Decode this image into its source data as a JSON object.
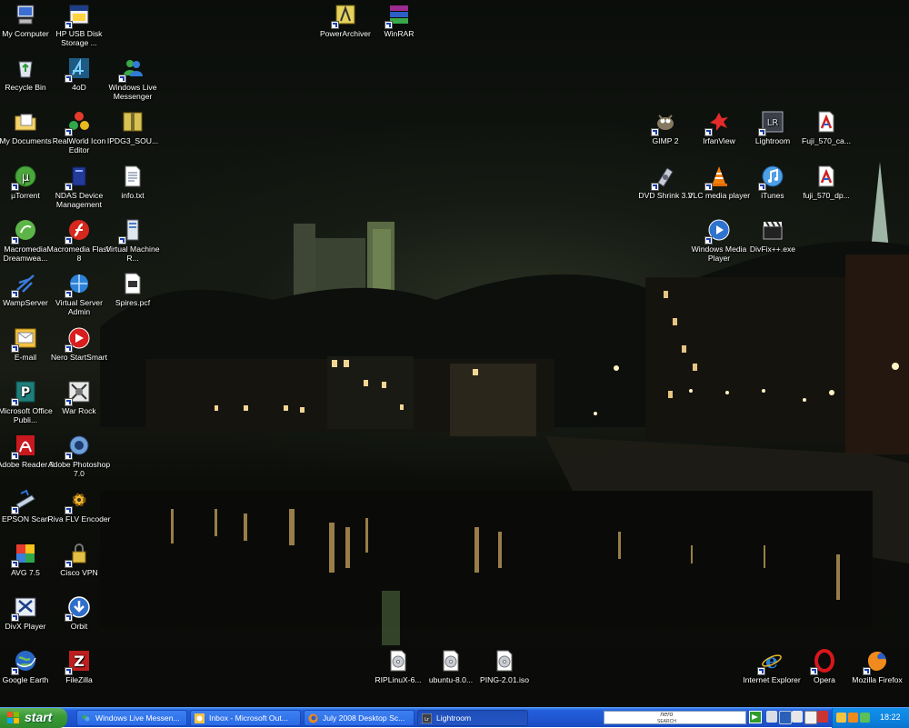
{
  "desktop": {
    "icons": {
      "my_computer": {
        "label": "My Computer",
        "icon": "computer-icon"
      },
      "hp_usb": {
        "label": "HP USB Disk Storage ...",
        "icon": "usb-disk-icon"
      },
      "recycle_bin": {
        "label": "Recycle Bin",
        "icon": "recycle-bin-icon"
      },
      "fourod": {
        "label": "4oD",
        "icon": "4od-icon"
      },
      "wlm": {
        "label": "Windows Live Messenger",
        "icon": "messenger-icon"
      },
      "my_documents": {
        "label": "My Documents",
        "icon": "folder-icon"
      },
      "realworld": {
        "label": "RealWorld Icon Editor",
        "icon": "icon-editor-icon"
      },
      "ipdg3": {
        "label": "IPDG3_SOU...",
        "icon": "archive-icon"
      },
      "utorrent": {
        "label": "µTorrent",
        "icon": "utorrent-icon"
      },
      "ndas": {
        "label": "NDAS Device Management",
        "icon": "ndas-icon"
      },
      "info_txt": {
        "label": "info.txt",
        "icon": "text-file-icon"
      },
      "dreamweaver": {
        "label": "Macromedia Dreamwea...",
        "icon": "dreamweaver-icon"
      },
      "flash": {
        "label": "Macromedia Flash 8",
        "icon": "flash-icon"
      },
      "vm": {
        "label": "Virtual Machine R...",
        "icon": "virtual-machine-icon"
      },
      "wamp": {
        "label": "WampServer",
        "icon": "wampserver-icon"
      },
      "vsa": {
        "label": "Virtual Server Admin",
        "icon": "virtual-server-icon"
      },
      "spires": {
        "label": "Spires.pcf",
        "icon": "pcf-file-icon"
      },
      "email": {
        "label": "E-mail",
        "icon": "email-icon"
      },
      "nero": {
        "label": "Nero StartSmart",
        "icon": "nero-icon"
      },
      "office_pub": {
        "label": "Microsoft Office Publi...",
        "icon": "publisher-icon"
      },
      "warrock": {
        "label": "War Rock",
        "icon": "war-rock-icon"
      },
      "adobe_reader": {
        "label": "Adobe Reader 8",
        "icon": "adobe-reader-icon"
      },
      "photoshop": {
        "label": "Adobe Photoshop 7.0",
        "icon": "photoshop-icon"
      },
      "epson": {
        "label": "EPSON Scan",
        "icon": "scanner-icon"
      },
      "riva": {
        "label": "Riva FLV Encoder",
        "icon": "riva-icon"
      },
      "avg": {
        "label": "AVG 7.5",
        "icon": "avg-icon"
      },
      "cisco": {
        "label": "Cisco VPN",
        "icon": "vpn-lock-icon"
      },
      "divx": {
        "label": "DivX Player",
        "icon": "divx-icon"
      },
      "orbit": {
        "label": "Orbit",
        "icon": "orbit-download-icon"
      },
      "google_earth": {
        "label": "Google Earth",
        "icon": "globe-icon"
      },
      "filezilla": {
        "label": "FileZilla",
        "icon": "filezilla-icon"
      },
      "powerarchiver": {
        "label": "PowerArchiver",
        "icon": "archiver-icon"
      },
      "winrar": {
        "label": "WinRAR",
        "icon": "winrar-icon"
      },
      "gimp": {
        "label": "GIMP 2",
        "icon": "gimp-icon"
      },
      "irfanview": {
        "label": "IrfanView",
        "icon": "irfanview-icon"
      },
      "lightroom": {
        "label": "Lightroom",
        "icon": "lightroom-icon"
      },
      "fuji_ca": {
        "label": "Fuji_570_ca...",
        "icon": "pdf-icon"
      },
      "dvdshrink": {
        "label": "DVD Shrink 3.2",
        "icon": "dvd-shrink-icon"
      },
      "vlc": {
        "label": "VLC media player",
        "icon": "vlc-cone-icon"
      },
      "itunes": {
        "label": "iTunes",
        "icon": "itunes-icon"
      },
      "fuji_dp": {
        "label": "fuji_570_dp...",
        "icon": "pdf-icon"
      },
      "wmp": {
        "label": "Windows Media Player",
        "icon": "media-player-icon"
      },
      "divxfix": {
        "label": "DivFix++.exe",
        "icon": "clapperboard-icon"
      },
      "riplinux": {
        "label": "RIPLinuX-6...",
        "icon": "disc-image-icon"
      },
      "ubuntu": {
        "label": "ubuntu-8.0...",
        "icon": "disc-image-icon"
      },
      "ping": {
        "label": "PING-2.01.iso",
        "icon": "disc-image-icon"
      },
      "ie": {
        "label": "Internet Explorer",
        "icon": "internet-explorer-icon"
      },
      "opera": {
        "label": "Opera",
        "icon": "opera-icon"
      },
      "firefox": {
        "label": "Mozilla Firefox",
        "icon": "firefox-icon"
      }
    }
  },
  "taskbar": {
    "start_label": "start",
    "tasks": [
      {
        "label": "Windows Live Messen...",
        "icon": "messenger-icon"
      },
      {
        "label": "Inbox - Microsoft Out...",
        "icon": "outlook-icon"
      },
      {
        "label": "July 2008 Desktop Sc...",
        "icon": "firefox-icon"
      },
      {
        "label": "Lightroom",
        "icon": "lightroom-icon"
      }
    ],
    "search": {
      "brand": "nero",
      "sub": "SEARCH",
      "placeholder": ""
    },
    "clock": "18:22"
  },
  "colors": {
    "taskbar_blue": "#245edb",
    "start_green": "#3c9a37",
    "tray_blue": "#0d86e2"
  }
}
